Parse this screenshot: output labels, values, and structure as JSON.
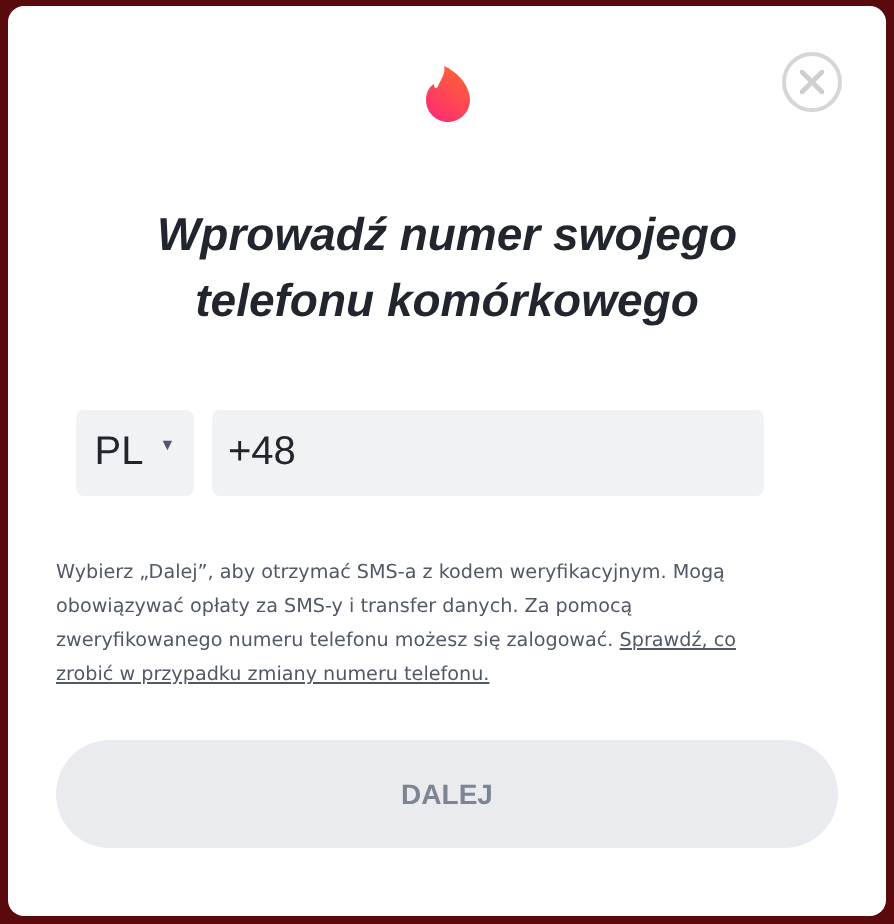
{
  "dialog": {
    "title": "Wprowadź numer swojego telefonu komórkowego",
    "country": {
      "code": "PL",
      "caret": "▼"
    },
    "phone": {
      "value": "+48"
    },
    "notice": {
      "text": "Wybierz „Dalej”, aby otrzymać SMS-a z kodem weryfikacyjnym. Mogą obowiązywać opłaty za SMS-y i transfer danych. Za pomocą zweryfikowanego numeru telefonu możesz się zalogować.",
      "link": "Sprawdź, co zrobić w przypadku zmiany numeru telefonu."
    },
    "button": {
      "label": "DALEJ",
      "disabled": true
    }
  }
}
